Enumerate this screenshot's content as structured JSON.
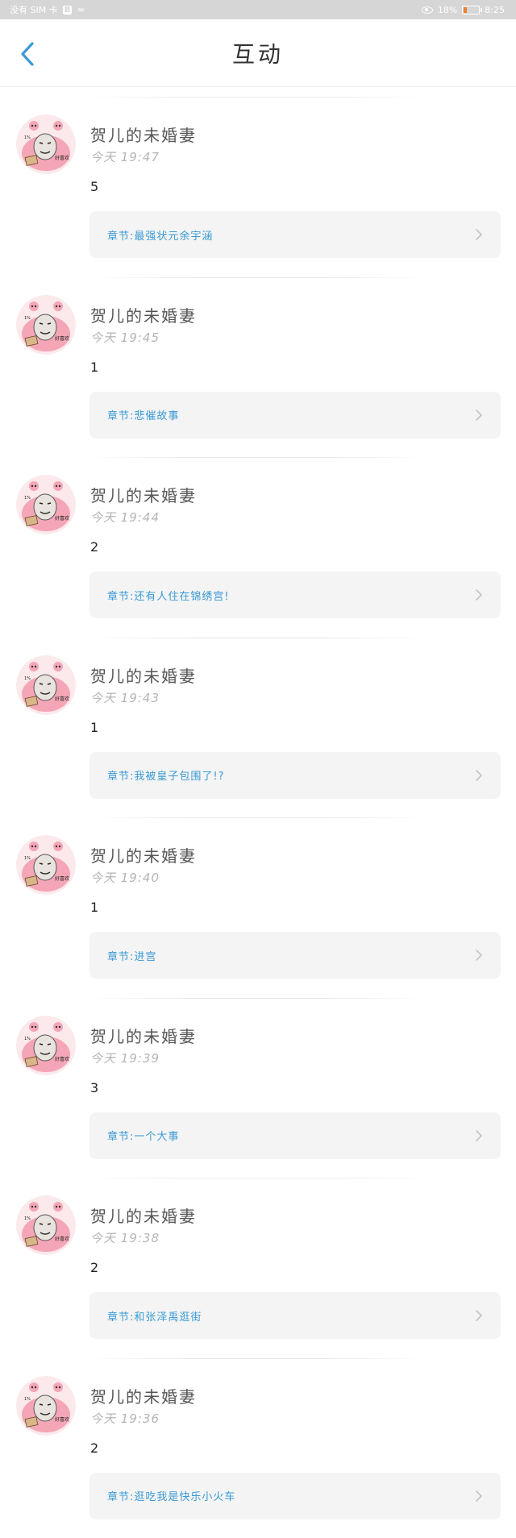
{
  "status_bar": {
    "carrier": "没有 SIM 卡",
    "sim_badge": "B",
    "battery": "18%",
    "time": "8:25"
  },
  "header": {
    "title": "互动"
  },
  "items": [
    {
      "username": "贺儿的未婚妻",
      "time": "今天 19:47",
      "content": "5",
      "chapter": "章节:最强状元余宇涵"
    },
    {
      "username": "贺儿的未婚妻",
      "time": "今天 19:45",
      "content": "1",
      "chapter": "章节:悲催故事"
    },
    {
      "username": "贺儿的未婚妻",
      "time": "今天 19:44",
      "content": "2",
      "chapter": "章节:还有人住在锦绣宫!"
    },
    {
      "username": "贺儿的未婚妻",
      "time": "今天 19:43",
      "content": "1",
      "chapter": "章节:我被皇子包围了!?"
    },
    {
      "username": "贺儿的未婚妻",
      "time": "今天 19:40",
      "content": "1",
      "chapter": "章节:进宫"
    },
    {
      "username": "贺儿的未婚妻",
      "time": "今天 19:39",
      "content": "3",
      "chapter": "章节:一个大事"
    },
    {
      "username": "贺儿的未婚妻",
      "time": "今天 19:38",
      "content": "2",
      "chapter": "章节:和张泽禹逛街"
    },
    {
      "username": "贺儿的未婚妻",
      "time": "今天 19:36",
      "content": "2",
      "chapter": "章节:逛吃我是快乐小火车"
    }
  ],
  "colors": {
    "accent": "#3a9ad6",
    "card_bg": "#f4f4f4",
    "status_bar_bg": "#d6d6d6"
  },
  "icons": {
    "back": "chevron-left-icon",
    "chapter_arrow": "chevron-right-icon",
    "avatar": "pig-meme-avatar"
  }
}
